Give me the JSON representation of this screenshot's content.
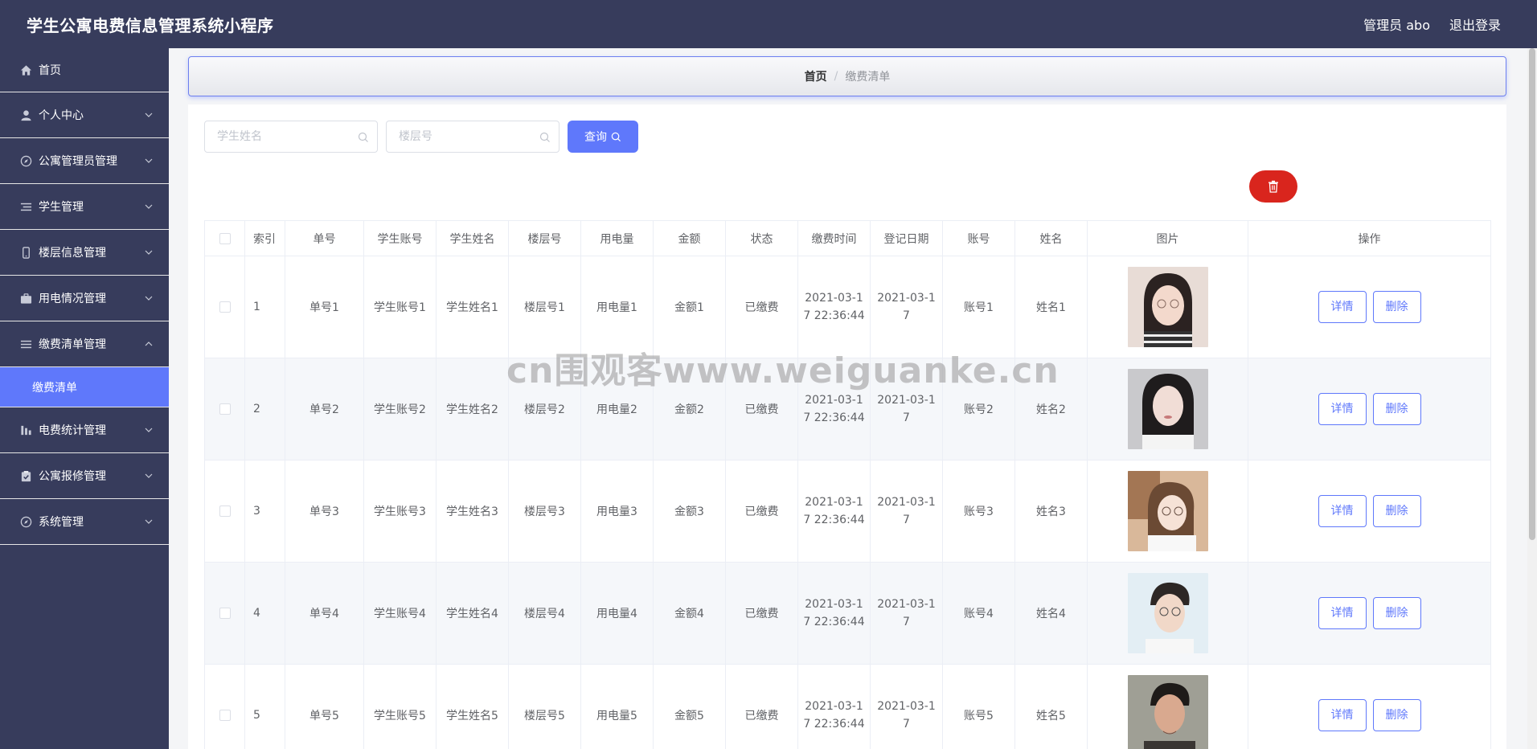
{
  "header": {
    "title": "学生公寓电费信息管理系统小程序",
    "user_label": "管理员 abo",
    "logout_label": "退出登录"
  },
  "sidebar": {
    "items": [
      {
        "label": "首页",
        "icon": "home-icon"
      },
      {
        "label": "个人中心",
        "icon": "user-icon"
      },
      {
        "label": "公寓管理员管理",
        "icon": "compass-icon"
      },
      {
        "label": "学生管理",
        "icon": "list-icon"
      },
      {
        "label": "楼层信息管理",
        "icon": "phone-icon"
      },
      {
        "label": "用电情况管理",
        "icon": "briefcase-icon"
      },
      {
        "label": "缴费清单管理",
        "icon": "menu-icon"
      },
      {
        "label": "电费统计管理",
        "icon": "chart-icon"
      },
      {
        "label": "公寓报修管理",
        "icon": "clipboard-icon"
      },
      {
        "label": "系统管理",
        "icon": "compass-icon"
      }
    ],
    "active_sub": "缴费清单"
  },
  "breadcrumb": {
    "home": "首页",
    "separator": "/",
    "current": "缴费清单"
  },
  "search": {
    "student_name_placeholder": "学生姓名",
    "floor_placeholder": "楼层号",
    "query_label": "查询"
  },
  "table": {
    "headers": [
      "索引",
      "单号",
      "学生账号",
      "学生姓名",
      "楼层号",
      "用电量",
      "金额",
      "状态",
      "缴费时间",
      "登记日期",
      "账号",
      "姓名",
      "图片",
      "操作"
    ],
    "detail_label": "详情",
    "delete_label": "删除",
    "rows": [
      {
        "index": "1",
        "order_no": "单号1",
        "student_account": "学生账号1",
        "student_name": "学生姓名1",
        "floor": "楼层号1",
        "usage": "用电量1",
        "amount": "金额1",
        "status": "已缴费",
        "pay_time": "2021-03-17 22:36:44",
        "reg_date": "2021-03-17",
        "account": "账号1",
        "name": "姓名1"
      },
      {
        "index": "2",
        "order_no": "单号2",
        "student_account": "学生账号2",
        "student_name": "学生姓名2",
        "floor": "楼层号2",
        "usage": "用电量2",
        "amount": "金额2",
        "status": "已缴费",
        "pay_time": "2021-03-17 22:36:44",
        "reg_date": "2021-03-17",
        "account": "账号2",
        "name": "姓名2"
      },
      {
        "index": "3",
        "order_no": "单号3",
        "student_account": "学生账号3",
        "student_name": "学生姓名3",
        "floor": "楼层号3",
        "usage": "用电量3",
        "amount": "金额3",
        "status": "已缴费",
        "pay_time": "2021-03-17 22:36:44",
        "reg_date": "2021-03-17",
        "account": "账号3",
        "name": "姓名3"
      },
      {
        "index": "4",
        "order_no": "单号4",
        "student_account": "学生账号4",
        "student_name": "学生姓名4",
        "floor": "楼层号4",
        "usage": "用电量4",
        "amount": "金额4",
        "status": "已缴费",
        "pay_time": "2021-03-17 22:36:44",
        "reg_date": "2021-03-17",
        "account": "账号4",
        "name": "姓名4"
      },
      {
        "index": "5",
        "order_no": "单号5",
        "student_account": "学生账号5",
        "student_name": "学生姓名5",
        "floor": "楼层号5",
        "usage": "用电量5",
        "amount": "金额5",
        "status": "已缴费",
        "pay_time": "2021-03-17 22:36:44",
        "reg_date": "2021-03-17",
        "account": "账号5",
        "name": "姓名5"
      }
    ]
  },
  "watermark": "cn围观客www.weiguanke.cn",
  "colors": {
    "sidebar_bg": "#373c5c",
    "accent": "#5f78fb",
    "danger": "#d9251d"
  }
}
